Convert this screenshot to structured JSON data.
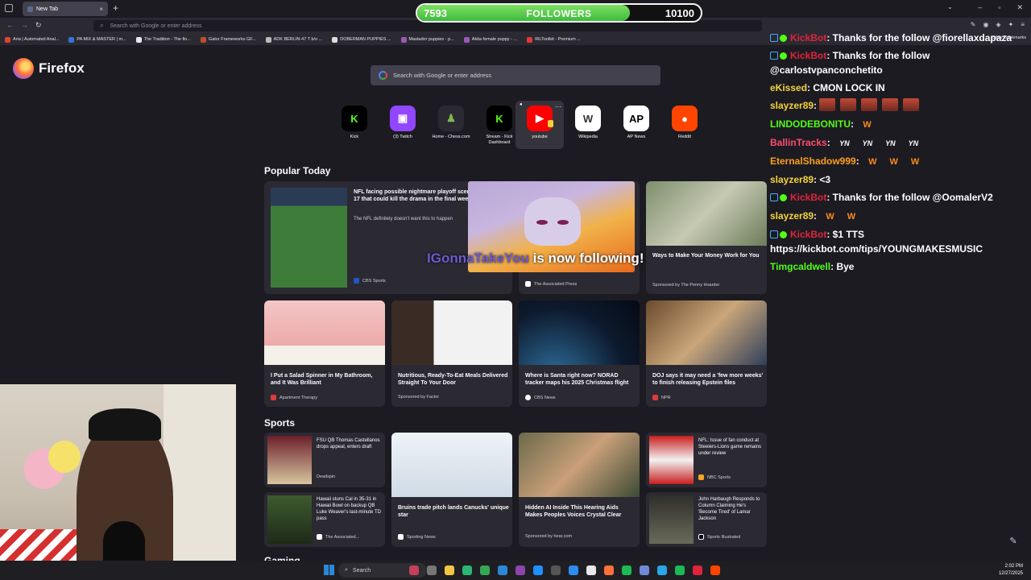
{
  "browser": {
    "tab_title": "New Tab",
    "new_tab_symbol": "+",
    "tab_close_symbol": "×",
    "url_placeholder": "Search with Google or enter address",
    "bookmarks": [
      {
        "label": "Aria | Automated Anal...",
        "color": "#e0442b"
      },
      {
        "label": "PA MIX & MASTER | m...",
        "color": "#3a6fd8"
      },
      {
        "label": "The Tradition - The fin...",
        "color": "#e8e8e8"
      },
      {
        "label": "Gator Frameworks GF...",
        "color": "#c04d2b"
      },
      {
        "label": "ADK BERLIN-47 T b/o ...",
        "color": "#bbbbbb"
      },
      {
        "label": "DOBERMAN PUPPIES ...",
        "color": "#dddddd"
      },
      {
        "label": "Mastador puppies - p...",
        "color": "#9b59b6"
      },
      {
        "label": "Akita female puppy - ...",
        "color": "#9b59b6"
      },
      {
        "label": "IRLToolkit - Premium ...",
        "color": "#e03a3a"
      }
    ],
    "other_bookmarks": "Other Bookmarks"
  },
  "followers_goal": {
    "current": "7593",
    "label": "FOLLOWERS",
    "goal": "10100",
    "progress": 0.75
  },
  "page": {
    "logo_text": "Firefox",
    "search_placeholder": "Search with Google or enter address",
    "shortcuts": [
      {
        "label": "Kick",
        "glyph": "K",
        "bg": "#000000",
        "fg": "#53fc18"
      },
      {
        "label": "(3) Twitch",
        "glyph": "▣",
        "bg": "#9146ff",
        "fg": "#ffffff"
      },
      {
        "label": "Home - Chess.com",
        "glyph": "♟",
        "bg": "#2b2a33",
        "fg": "#81b64c"
      },
      {
        "label": "Stream - Kick Dashboard",
        "glyph": "K",
        "bg": "#000000",
        "fg": "#53fc18"
      },
      {
        "label": "youtube",
        "glyph": "▶",
        "bg": "#ff0000",
        "fg": "#ffffff"
      },
      {
        "label": "Wikipedia",
        "glyph": "W",
        "bg": "#ffffff",
        "fg": "#333333"
      },
      {
        "label": "AP News",
        "glyph": "AP",
        "bg": "#ffffff",
        "fg": "#000000"
      },
      {
        "label": "Reddit",
        "glyph": "●",
        "bg": "#ff4500",
        "fg": "#ffffff"
      }
    ],
    "popular_title": "Popular Today",
    "popular_cards": [
      {
        "title": "NFL facing possible nightmare playoff scenario in Week 17 that could kill the drama in the final week of season",
        "desc": "The NFL definitely doesn't want this to happen",
        "source": "CBS Sports",
        "src_color": "#1f56c6"
      },
      {
        "title": "",
        "desc": "",
        "source": "The Associated Press",
        "src_color": "#ffffff"
      },
      {
        "title": "Ways to Make Your Money Work for You",
        "desc": "",
        "source": "Sponsored by The Penny Hoarder",
        "src_color": ""
      }
    ],
    "row2_cards": [
      {
        "title": "I Put a Salad Spinner in My Bathroom, and It Was Brilliant",
        "source": "Apartment Therapy",
        "src_color": "#e03a3a"
      },
      {
        "title": "Nutritious, Ready-To-Eat Meals Delivered Straight To Your Door",
        "source": "Sponsored by Factor",
        "src_color": ""
      },
      {
        "title": "Where is Santa right now? NORAD tracker maps his 2025 Christmas flight",
        "source": "CBS News",
        "src_color": "#ffffff"
      },
      {
        "title": "DOJ says it may need a 'few more weeks' to finish releasing Epstein files",
        "source": "NPR",
        "src_color": "#e03a3a"
      }
    ],
    "sports_title": "Sports",
    "sports_cards": [
      {
        "title": "FSU QB Thomas Castellanos drops appeal, enters draft",
        "source": "Deadspin",
        "src_color": ""
      },
      {
        "title": "",
        "source": "",
        "src_color": ""
      },
      {
        "title": "",
        "source": "",
        "src_color": ""
      },
      {
        "title": "NFL: Issue of fan conduct at Steelers-Lions game remains under review",
        "source": "NBC Sports",
        "src_color": "#f5a623"
      },
      {
        "title": "Hawaii stuns Cal in 35-31 in Hawaii Bowl on backup QB Luke Weaver's last-minute TD pass",
        "source": "The Associated...",
        "src_color": "#ffffff"
      },
      {
        "title": "Bruins trade pitch lands Canucks' unique star",
        "source": "Sporting News",
        "src_color": "#ffffff"
      },
      {
        "title": "Hidden AI Inside This Hearing Aids Makes Peoples Voices Crystal Clear",
        "source": "Sponsored by hear.com",
        "src_color": ""
      },
      {
        "title": "John Harbaugh Responds to Column Claiming He's 'Become Tired' of Lamar Jackson",
        "source": "Sports Illustrated",
        "src_color": "#000000"
      }
    ],
    "gaming_title": "Gaming"
  },
  "alert": {
    "name": "IGonnaTakeYou",
    "text": " is now following!"
  },
  "chat": [
    {
      "user": "KickBot",
      "color": "#e0243c",
      "text": ": Thanks for the follow @fiorellaxdapaza",
      "bot": true
    },
    {
      "user": "KickBot",
      "color": "#e0243c",
      "text": ": Thanks for the follow",
      "bot": true
    },
    {
      "user": "",
      "color": "#ffffff",
      "text": "@carlostvpanconchetito",
      "bot": false
    },
    {
      "user": "eKissed",
      "color": "#f5d33b",
      "text": ": CMON LOCK IN",
      "bot": false
    },
    {
      "user": "slayzer89",
      "color": "#f5d33b",
      "text": ": ",
      "bot": false
    },
    {
      "user": "LINDODEBONITU",
      "color": "#53fc18",
      "text": ": ",
      "bot": false
    },
    {
      "user": "BallinTracks",
      "color": "#ff4d6d",
      "text": ": ",
      "bot": false
    },
    {
      "user": "EternalShadow999",
      "color": "#ff9f1c",
      "text": ": ",
      "bot": false
    },
    {
      "user": "slayzer89",
      "color": "#f5d33b",
      "text": ": <3",
      "bot": false
    },
    {
      "user": "KickBot",
      "color": "#e0243c",
      "text": ": Thanks for the follow @OomalerV2",
      "bot": true
    },
    {
      "user": "slayzer89",
      "color": "#f5d33b",
      "text": ": ",
      "bot": false
    },
    {
      "user": "KickBot",
      "color": "#e0243c",
      "text": ": $1 TTS",
      "bot": true
    },
    {
      "user": "",
      "color": "#ffffff",
      "text": "https://kickbot.com/tips/YOUNGMAKESMUSIC",
      "bot": false
    },
    {
      "user": "Timgcaldwell",
      "color": "#53fc18",
      "text": ": Bye",
      "bot": false
    }
  ],
  "emotes": {
    "w": "W",
    "yn": "YN"
  },
  "taskbar": {
    "search_label": "Search",
    "time": "2:02 PM",
    "date": "12/27/2025"
  }
}
